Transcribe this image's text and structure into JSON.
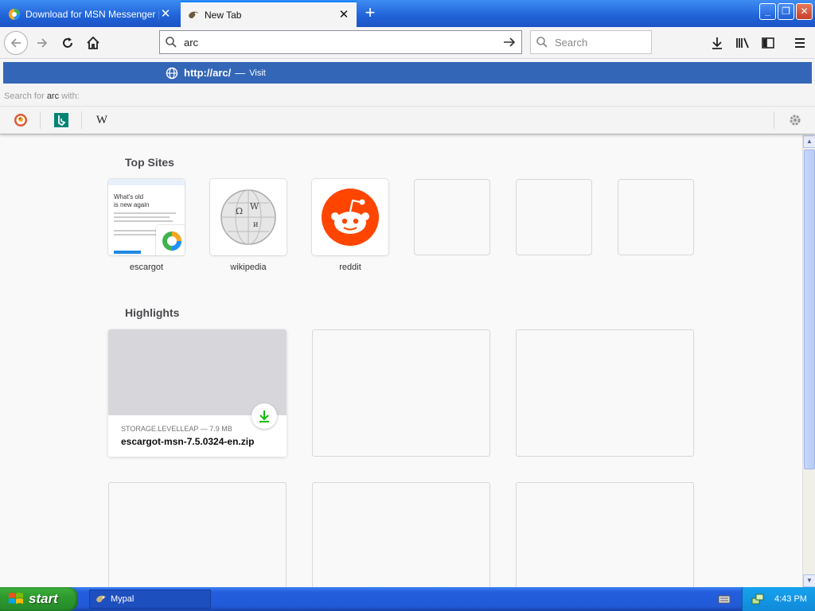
{
  "browser": {
    "tabs": [
      {
        "title": "Download for MSN Messenger | Escargot",
        "active": false
      },
      {
        "title": "New Tab",
        "active": true
      }
    ],
    "window_buttons": {
      "minimize": "_",
      "maximize": "❐",
      "close": "✕"
    },
    "url_value": "arc",
    "search_placeholder": "Search"
  },
  "autocomplete": {
    "url_prefix": "http://",
    "url_query": "arc",
    "url_suffix": "/",
    "separator": "—",
    "action": "Visit",
    "search_for_prefix": "Search for",
    "search_for_query": "arc",
    "search_for_suffix": "with:",
    "engines": [
      "duckduckgo",
      "bing",
      "wikipedia"
    ],
    "wikipedia_glyph": "W"
  },
  "newtab": {
    "top_sites_title": "Top Sites",
    "top_sites": [
      {
        "label": "escargot",
        "preview_heading_1": "What's old",
        "preview_heading_2": "is new again"
      },
      {
        "label": "wikipedia"
      },
      {
        "label": "reddit"
      },
      {
        "label": ""
      },
      {
        "label": ""
      },
      {
        "label": ""
      }
    ],
    "highlights_title": "Highlights",
    "highlight": {
      "meta": "STORAGE.LEVELLEAP — 7.9 MB",
      "filename": "escargot-msn-7.5.0324-en.zip"
    }
  },
  "taskbar": {
    "start_label": "start",
    "task_label": "Mypal",
    "clock": "4:43 PM"
  },
  "colors": {
    "accent": "#0a84ff",
    "popup_highlight": "#3366b7",
    "reddit": "#ff4500",
    "download_green": "#12bc00"
  }
}
